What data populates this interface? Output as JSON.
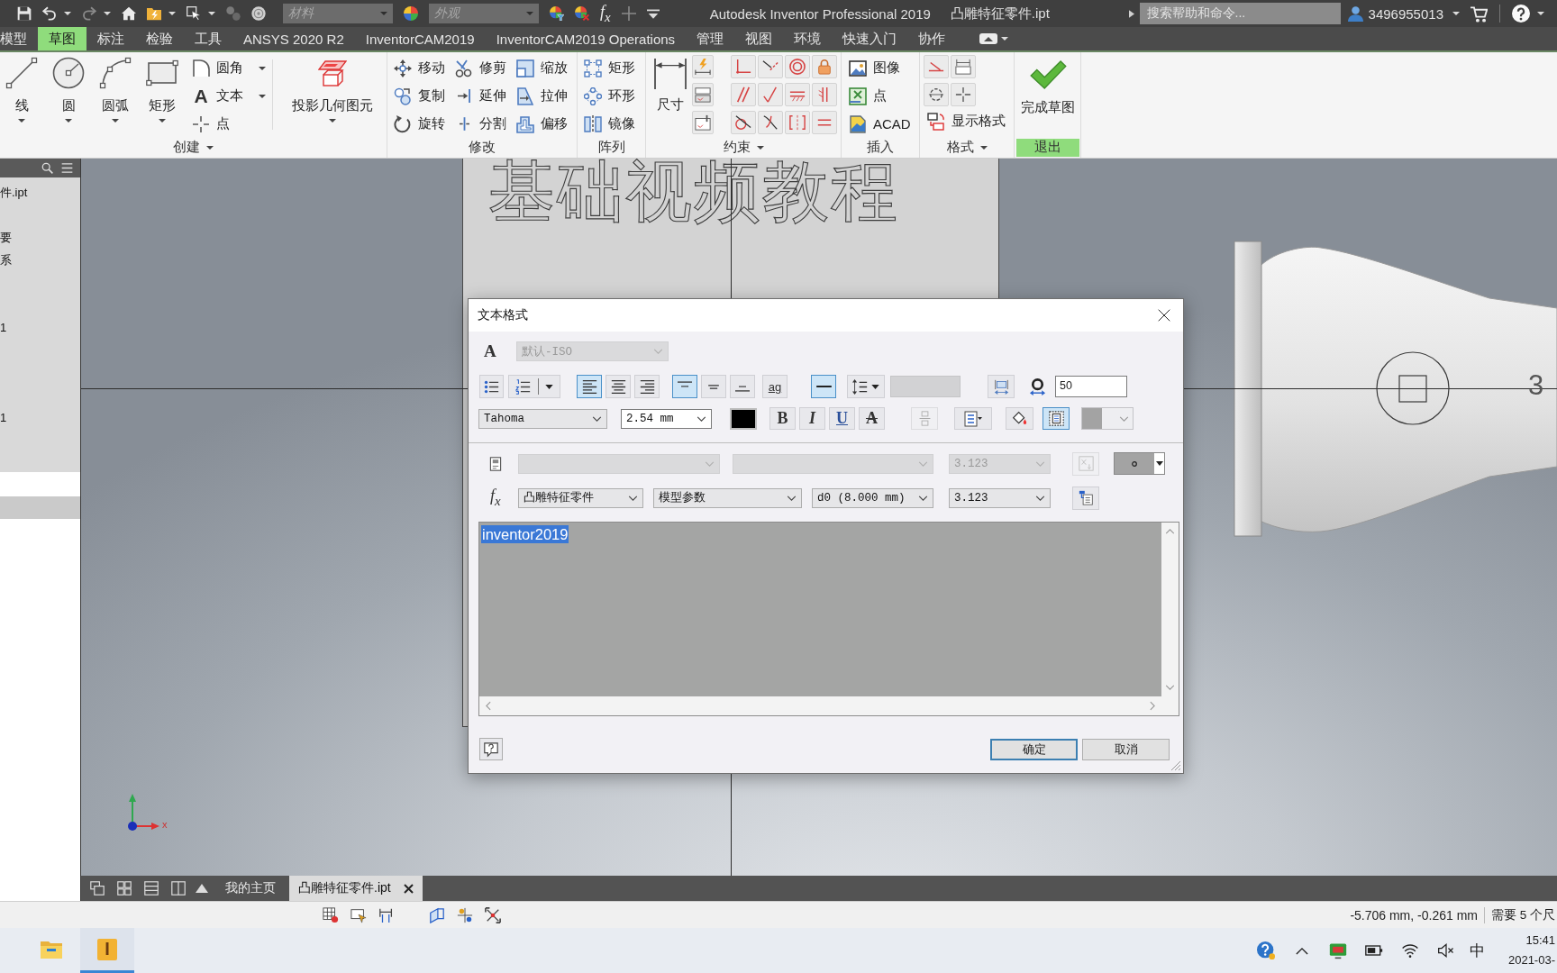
{
  "title_bar": {
    "material": {
      "placeholder": "材料"
    },
    "appearance": {
      "placeholder": "外观"
    },
    "formula": "f$_{x}$",
    "title": "Autodesk Inventor Professional 2019",
    "document": "凸雕特征零件.ipt",
    "search": {
      "placeholder": "搜索帮助和命令..."
    },
    "user": "3496955013"
  },
  "ribbon_tabs": [
    {
      "label": "模型",
      "selected": false
    },
    {
      "label": "草图",
      "selected": true
    },
    {
      "label": "标注",
      "selected": false
    },
    {
      "label": "检验",
      "selected": false
    },
    {
      "label": "工具",
      "selected": false
    },
    {
      "label": "ANSYS 2020 R2",
      "selected": false
    },
    {
      "label": "InventorCAM2019",
      "selected": false
    },
    {
      "label": "InventorCAM2019 Operations",
      "selected": false
    },
    {
      "label": "管理",
      "selected": false
    },
    {
      "label": "视图",
      "selected": false
    },
    {
      "label": "环境",
      "selected": false
    },
    {
      "label": "快速入门",
      "selected": false
    },
    {
      "label": "协作",
      "selected": false
    }
  ],
  "ribbon": {
    "groups": [
      {
        "label": "创建",
        "menu": true,
        "highlighted": false,
        "large": [
          {
            "label": "线",
            "menu": true
          },
          {
            "label": "圆",
            "menu": true
          },
          {
            "label": "圆弧",
            "menu": true
          },
          {
            "label": "矩形",
            "menu": true
          }
        ],
        "small": [
          {
            "label": "圆角",
            "menu": true
          },
          {
            "label": "文本",
            "glyph": "A",
            "menu": true
          },
          {
            "label": "点",
            "menu": false
          }
        ],
        "wide": {
          "label": "投影几何图元",
          "menu": true
        }
      },
      {
        "label": "修改",
        "menu": false,
        "highlighted": false,
        "small": [
          {
            "label": "移动"
          },
          {
            "label": "复制"
          },
          {
            "label": "旋转"
          },
          {
            "label": "修剪"
          },
          {
            "label": "延伸"
          },
          {
            "label": "分割"
          },
          {
            "label": "缩放"
          },
          {
            "label": "拉伸"
          },
          {
            "label": "偏移"
          }
        ]
      },
      {
        "label": "阵列",
        "menu": false,
        "highlighted": false,
        "small": [
          {
            "label": "矩形"
          },
          {
            "label": "环形"
          },
          {
            "label": "镜像"
          }
        ]
      },
      {
        "label": "约束",
        "menu": true,
        "highlighted": false,
        "large": [
          {
            "label": "尺寸",
            "menu": false
          }
        ]
      },
      {
        "label": "插入",
        "menu": false,
        "highlighted": false,
        "small": [
          {
            "label": "图像"
          },
          {
            "label": "点"
          },
          {
            "label": "ACAD"
          }
        ]
      },
      {
        "label": "格式",
        "menu": true,
        "highlighted": false,
        "small": [
          {
            "label": "显示格式"
          }
        ]
      },
      {
        "label": "退出",
        "menu": false,
        "highlighted": true,
        "large": [
          {
            "label": "完成草图",
            "menu": false
          }
        ]
      }
    ]
  },
  "browser": {
    "rows": [
      {
        "label": "件.ipt",
        "selected": false
      },
      {
        "label": "要",
        "selected": false
      },
      {
        "label": "系",
        "selected": false
      },
      {
        "label": "1",
        "selected": false
      },
      {
        "label": "1",
        "selected": false
      },
      {
        "selected": true
      }
    ]
  },
  "viewport": {
    "sketch_text": "基础视频教程",
    "dimension": "3",
    "axis_label": "x"
  },
  "dialog": {
    "title": "文本格式",
    "style": {
      "glyph": "A",
      "value": "默认-ISO",
      "disabled": true
    },
    "alignment": [
      {
        "selected": true
      },
      {
        "selected": false
      },
      {
        "selected": false
      }
    ],
    "vertical_alignment": [
      {
        "selected": true
      },
      {
        "selected": false
      },
      {
        "selected": false
      }
    ],
    "sample_button": "ag",
    "line_toggle": {
      "on": true
    },
    "number_field": {
      "value": "50"
    },
    "font": {
      "value": "Tahoma"
    },
    "size": {
      "value": "2.54 mm"
    },
    "style_buttons": [
      {
        "kind": "bold",
        "label": "B"
      },
      {
        "kind": "italic",
        "label": "I"
      },
      {
        "kind": "underline",
        "label": "U"
      },
      {
        "kind": "strike",
        "label": "A"
      }
    ],
    "frame_toggle": {
      "on": true
    },
    "property_row": {
      "disabled": true,
      "precision": "3.123"
    },
    "parameter_row": {
      "disabled": false,
      "formula": "f$_{x}$",
      "part": "凸雕特征零件",
      "source": "模型参数",
      "parameter": "d0 (8.000 mm)",
      "precision": "3.123"
    },
    "text": {
      "value": "inventor2019",
      "selected": true
    },
    "buttons": [
      {
        "label": "确定",
        "default": true
      },
      {
        "label": "取消",
        "default": false
      }
    ]
  },
  "document_tabs": [
    {
      "label": "我的主页",
      "selected": false,
      "closable": false
    },
    {
      "label": "凸雕特征零件.ipt",
      "selected": true,
      "closable": true
    }
  ],
  "status_bar": {
    "coordinates": "-5.706 mm, -0.261 mm",
    "message": "需要 5 个尺"
  },
  "taskbar": {
    "apps": [
      {
        "kind": "folder",
        "active": false
      },
      {
        "kind": "logo",
        "label": "I",
        "active": true
      }
    ],
    "ime": "中",
    "time": "15:41",
    "date": "2021-03-"
  }
}
